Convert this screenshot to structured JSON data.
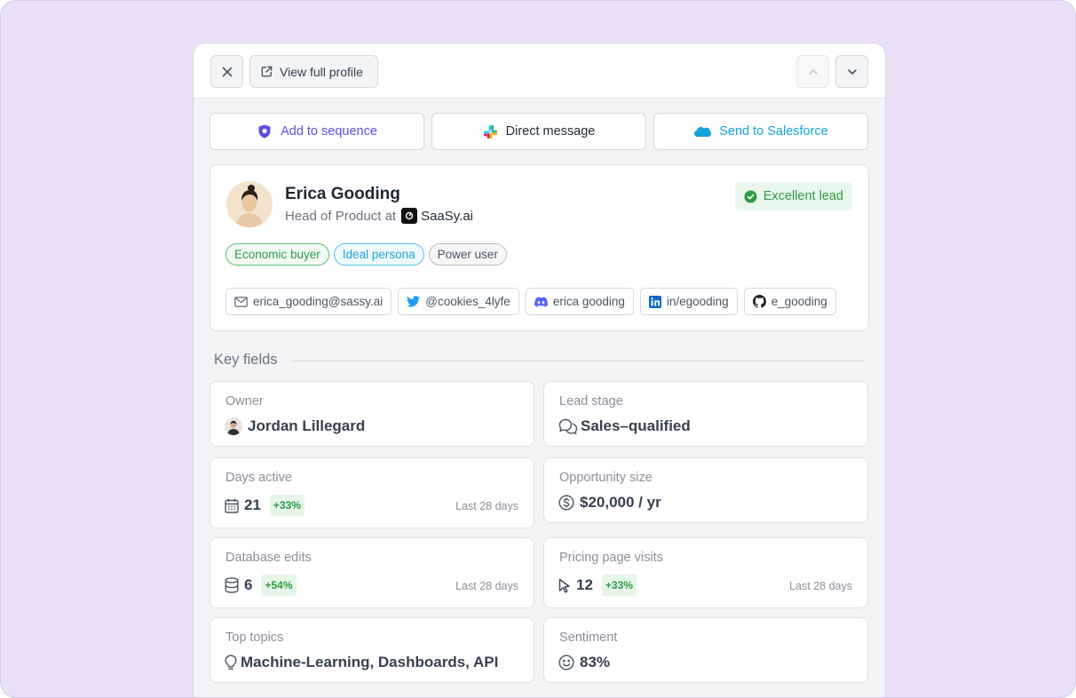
{
  "topbar": {
    "view_profile_label": "View full profile"
  },
  "actions": [
    {
      "label": "Add to sequence",
      "color": "#5b4de0"
    },
    {
      "label": "Direct message",
      "color": "#1f2937"
    },
    {
      "label": "Send to Salesforce",
      "color": "#16a3d9"
    }
  ],
  "profile": {
    "name": "Erica Gooding",
    "role_prefix": "Head of Product at",
    "company": "SaaSy.ai",
    "lead_badge": "Excellent lead",
    "tags": [
      "Economic buyer",
      "Ideal persona",
      "Power user"
    ],
    "socials": {
      "email": "erica_gooding@sassy.ai",
      "twitter": "@cookies_4lyfe",
      "discord": "erica gooding",
      "linkedin": "in/egooding",
      "github": "e_gooding"
    }
  },
  "key_fields": {
    "title": "Key fields",
    "owner": {
      "label": "Owner",
      "value": "Jordan Lillegard"
    },
    "lead_stage": {
      "label": "Lead stage",
      "value": "Sales–qualified"
    },
    "days_active": {
      "label": "Days active",
      "value": "21",
      "delta": "+33%",
      "period": "Last 28 days"
    },
    "opportunity_size": {
      "label": "Opportunity size",
      "value": "$20,000 / yr"
    },
    "database_edits": {
      "label": "Database edits",
      "value": "6",
      "delta": "+54%",
      "period": "Last 28 days"
    },
    "pricing_visits": {
      "label": "Pricing page visits",
      "value": "12",
      "delta": "+33%",
      "period": "Last 28 days"
    },
    "top_topics": {
      "label": "Top topics",
      "value": "Machine-Learning, Dashboards, API"
    },
    "sentiment": {
      "label": "Sentiment",
      "value": "83%"
    }
  },
  "colors": {
    "background": "#ebdff8",
    "positive": "#2f9a45",
    "accent_purple": "#5b4de0",
    "accent_blue": "#16a3d9"
  },
  "icons": [
    "close-icon",
    "external-link-icon",
    "chevron-up-icon",
    "chevron-down-icon",
    "shield-icon",
    "slack-icon",
    "salesforce-cloud-icon",
    "check-circle-icon",
    "mail-icon",
    "twitter-icon",
    "discord-icon",
    "linkedin-icon",
    "github-icon",
    "chat-icon",
    "calendar-icon",
    "dollar-circle-icon",
    "database-icon",
    "cursor-icon",
    "lightbulb-icon",
    "smile-icon"
  ]
}
